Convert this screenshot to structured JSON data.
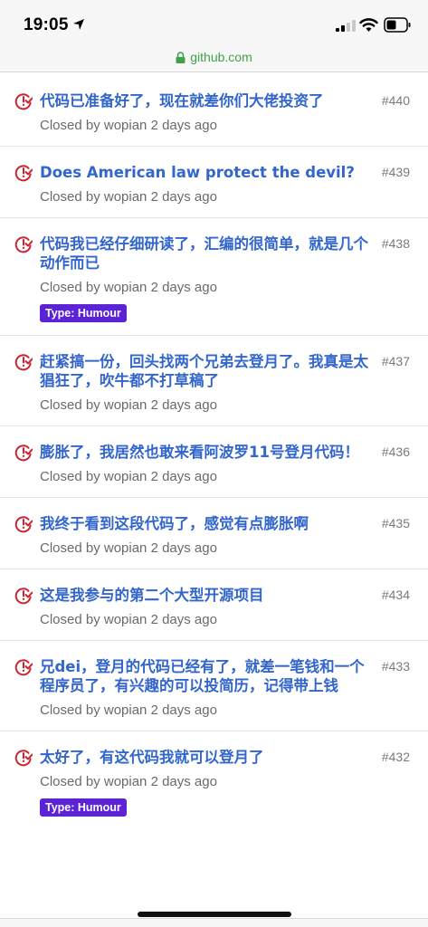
{
  "status_bar": {
    "time": "19:05",
    "icons": [
      "location-arrow-icon",
      "signal-icon",
      "wifi-icon",
      "battery-icon"
    ]
  },
  "browser": {
    "url": "github.com",
    "lock_icon": "lock-icon"
  },
  "issues": [
    {
      "title": "代码已准备好了，现在就差你们大佬投资了",
      "number": "#440",
      "meta": "Closed by wopian 2 days ago",
      "label": ""
    },
    {
      "title": "Does American law protect the devil?",
      "number": "#439",
      "meta": "Closed by wopian 2 days ago",
      "label": ""
    },
    {
      "title": "代码我已经仔细研读了，汇编的很简单，就是几个动作而已",
      "number": "#438",
      "meta": "Closed by wopian 2 days ago",
      "label": "Type: Humour"
    },
    {
      "title": "赶紧搞一份，回头找两个兄弟去登月了。我真是太猖狂了，吹牛都不打草稿了",
      "number": "#437",
      "meta": "Closed by wopian 2 days ago",
      "label": ""
    },
    {
      "title": "膨胀了，我居然也敢来看阿波罗11号登月代码！",
      "number": "#436",
      "meta": "Closed by wopian 2 days ago",
      "label": ""
    },
    {
      "title": "我终于看到这段代码了，感觉有点膨胀啊",
      "number": "#435",
      "meta": "Closed by wopian 2 days ago",
      "label": ""
    },
    {
      "title": "这是我参与的第二个大型开源项目",
      "number": "#434",
      "meta": "Closed by wopian 2 days ago",
      "label": ""
    },
    {
      "title": "兄dei，登月的代码已经有了，就差一笔钱和一个程序员了，有兴趣的可以投简历，记得带上钱",
      "number": "#433",
      "meta": "Closed by wopian 2 days ago",
      "label": ""
    },
    {
      "title": "太好了，有这代码我就可以登月了",
      "number": "#432",
      "meta": "Closed by wopian 2 days ago",
      "label": "Type: Humour"
    }
  ],
  "colors": {
    "title_link": "#3366cc",
    "closed_icon": "#cb2431",
    "label_bg": "#5b22d6",
    "secure_url": "#3fa14a"
  }
}
